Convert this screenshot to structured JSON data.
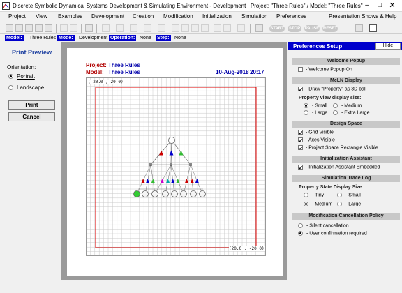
{
  "window": {
    "title": "Discrete Symbolic Dynamical Systems Development & Simulating Environment - Development  |  Project: \"Three Rules\" / Model: \"Three Rules\"",
    "minimize": "–",
    "maximize": "□",
    "close": "✕"
  },
  "menu": [
    "Project",
    "View",
    "Examples",
    "Development",
    "Creation",
    "Modification",
    "Initialization",
    "Simulation",
    "Preferences",
    "Presentation Shows & Help"
  ],
  "toolbar": {
    "pills": [
      "START",
      "STOP",
      "PAUSE",
      "RESET"
    ]
  },
  "status": {
    "model_label": "Model:",
    "model_value": "Three Rules",
    "mode_label": "Mode:",
    "mode_value": "Development",
    "operation_label": "Operation:",
    "operation_value": "None",
    "step_label": "Step:",
    "step_value": "None"
  },
  "print_preview": {
    "title": "Print Preview",
    "orientation_label": "Orientation:",
    "portrait": "Portrait",
    "landscape": "Landscape",
    "orientation_selected": "Portrait",
    "print_button": "Print",
    "cancel_button": "Cancel"
  },
  "page": {
    "project_label": "Project:",
    "project_value": "Three Rules",
    "model_label": "Model:",
    "model_value": "Three Rules",
    "date": "10-Aug-2018",
    "time": "20:17",
    "coord_top_left": "(-20.0 , 20.0)",
    "coord_bottom_right": "(20.0 , -20.0)"
  },
  "preferences": {
    "title": "Preferences Setup",
    "hide_button": "Hide",
    "sections": {
      "welcome": "Welcome Popup",
      "mcln": "McLN Display",
      "design": "Design Space",
      "init": "Initialization Assistant",
      "trace": "Simulation Trace Log",
      "modification": "Modification Cancellation Policy"
    },
    "welcome_popup_on": "- Welcome Popup On",
    "draw_property_3d": "- Draw \"Property\" as 3D ball",
    "property_view_size_label": "Property view display size:",
    "size_small": "- Small",
    "size_medium": "- Medium",
    "size_large": "- Large",
    "size_extra_large": "- Extra Large",
    "grid_visible": "- Grid Visible",
    "axes_visible": "- Axes Visible",
    "project_space_rect_visible": "- Project Space Rectangle Visible",
    "init_assistant_embedded": "- Initialization Assistant Embedded",
    "property_state_size_label": "Property State Display Size:",
    "trace_tiny": "- Tiny",
    "trace_small": "- Small",
    "trace_medium": "- Medium",
    "trace_large": "- Large",
    "silent_cancellation": "- Silent cancellation",
    "user_confirmation": "- User confirmation required"
  },
  "colors": {
    "accent_blue": "#0000cc",
    "project_red": "#b00000",
    "project_blue": "#0000aa",
    "grid_line": "#c8c8c8",
    "border_red": "#e00000",
    "node_green": "#33cc33"
  }
}
